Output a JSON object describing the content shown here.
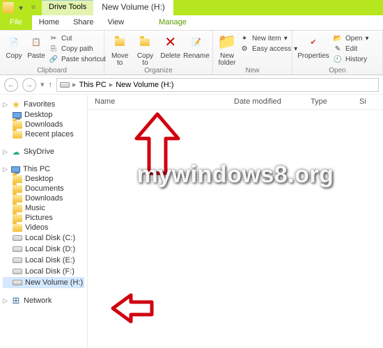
{
  "title": {
    "context_tab": "Drive Tools",
    "window_title": "New Volume (H:)"
  },
  "ribbon_tabs": {
    "file": "File",
    "home": "Home",
    "share": "Share",
    "view": "View",
    "manage": "Manage"
  },
  "ribbon": {
    "clipboard": {
      "copy": "Copy",
      "paste": "Paste",
      "cut": "Cut",
      "copy_path": "Copy path",
      "paste_shortcut": "Paste shortcut",
      "label": "Clipboard"
    },
    "organize": {
      "move_to": "Move\nto",
      "copy_to": "Copy\nto",
      "delete": "Delete",
      "rename": "Rename",
      "label": "Organize"
    },
    "new": {
      "new_folder": "New\nfolder",
      "new_item": "New item",
      "easy_access": "Easy access",
      "label": "New"
    },
    "open": {
      "properties": "Properties",
      "open": "Open",
      "edit": "Edit",
      "history": "History",
      "label": "Open"
    }
  },
  "addr": {
    "root": "This PC",
    "current": "New Volume (H:)"
  },
  "columns": {
    "name": "Name",
    "date": "Date modified",
    "type": "Type",
    "size": "Si"
  },
  "sidebar": {
    "favorites": {
      "label": "Favorites",
      "items": [
        "Desktop",
        "Downloads",
        "Recent places"
      ]
    },
    "skydrive": {
      "label": "SkyDrive"
    },
    "thispc": {
      "label": "This PC",
      "items": [
        "Desktop",
        "Documents",
        "Downloads",
        "Music",
        "Pictures",
        "Videos",
        "Local Disk (C:)",
        "Local Disk (D:)",
        "Local Disk (E:)",
        "Local Disk (F:)",
        "New Volume (H:)"
      ]
    },
    "network": {
      "label": "Network"
    }
  },
  "watermark": "mywindows8.org"
}
